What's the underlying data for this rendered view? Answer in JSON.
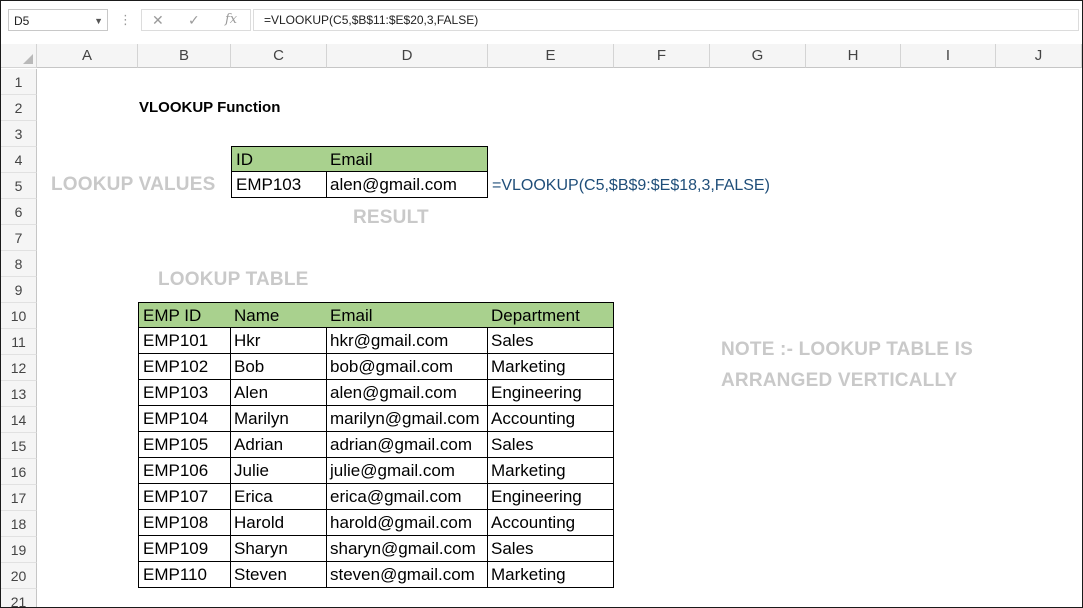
{
  "formula_bar": {
    "name_box": "D5",
    "name_box_dropdown_icon": "chevron-down-icon",
    "cancel_icon": "✕",
    "enter_icon": "✓",
    "fx_label": "fx",
    "formula": "=VLOOKUP(C5,$B$11:$E$20,3,FALSE)"
  },
  "columns": [
    "A",
    "B",
    "C",
    "D",
    "E",
    "F",
    "G",
    "H",
    "I",
    "J"
  ],
  "rows": [
    "1",
    "2",
    "3",
    "4",
    "5",
    "6",
    "7",
    "8",
    "9",
    "10",
    "11",
    "12",
    "13",
    "14",
    "15",
    "16",
    "17",
    "18",
    "19",
    "20",
    "21"
  ],
  "sheet": {
    "title": "VLOOKUP Function",
    "lookup_values_label": "LOOKUP VALUES",
    "result_label": "RESULT",
    "lookup_table_label": "LOOKUP TABLE",
    "note_line1": "NOTE :-  LOOKUP TABLE IS",
    "note_line2": "ARRANGED VERTICALLY",
    "formula_display": "=VLOOKUP(C5,$B$9:$E$18,3,FALSE)",
    "lookup": {
      "headers": [
        "ID",
        "Email"
      ],
      "values": [
        "EMP103",
        "alen@gmail.com"
      ]
    },
    "table": {
      "headers": [
        "EMP ID",
        "Name",
        "Email",
        "Department"
      ],
      "rows": [
        [
          "EMP101",
          "Hkr",
          "hkr@gmail.com",
          "Sales"
        ],
        [
          "EMP102",
          "Bob",
          "bob@gmail.com",
          "Marketing"
        ],
        [
          "EMP103",
          "Alen",
          "alen@gmail.com",
          "Engineering"
        ],
        [
          "EMP104",
          "Marilyn",
          "marilyn@gmail.com",
          "Accounting"
        ],
        [
          "EMP105",
          "Adrian",
          "adrian@gmail.com",
          "Sales"
        ],
        [
          "EMP106",
          "Julie",
          "julie@gmail.com",
          "Marketing"
        ],
        [
          "EMP107",
          "Erica",
          "erica@gmail.com",
          "Engineering"
        ],
        [
          "EMP108",
          "Harold",
          "harold@gmail.com",
          "Accounting"
        ],
        [
          "EMP109",
          "Sharyn",
          "sharyn@gmail.com",
          "Sales"
        ],
        [
          "EMP110",
          "Steven",
          "steven@gmail.com",
          "Marketing"
        ]
      ]
    }
  },
  "colors": {
    "header_fill": "#a9d18e",
    "formula_text": "#1f4e79",
    "watermark_text": "#c9c9c9"
  }
}
